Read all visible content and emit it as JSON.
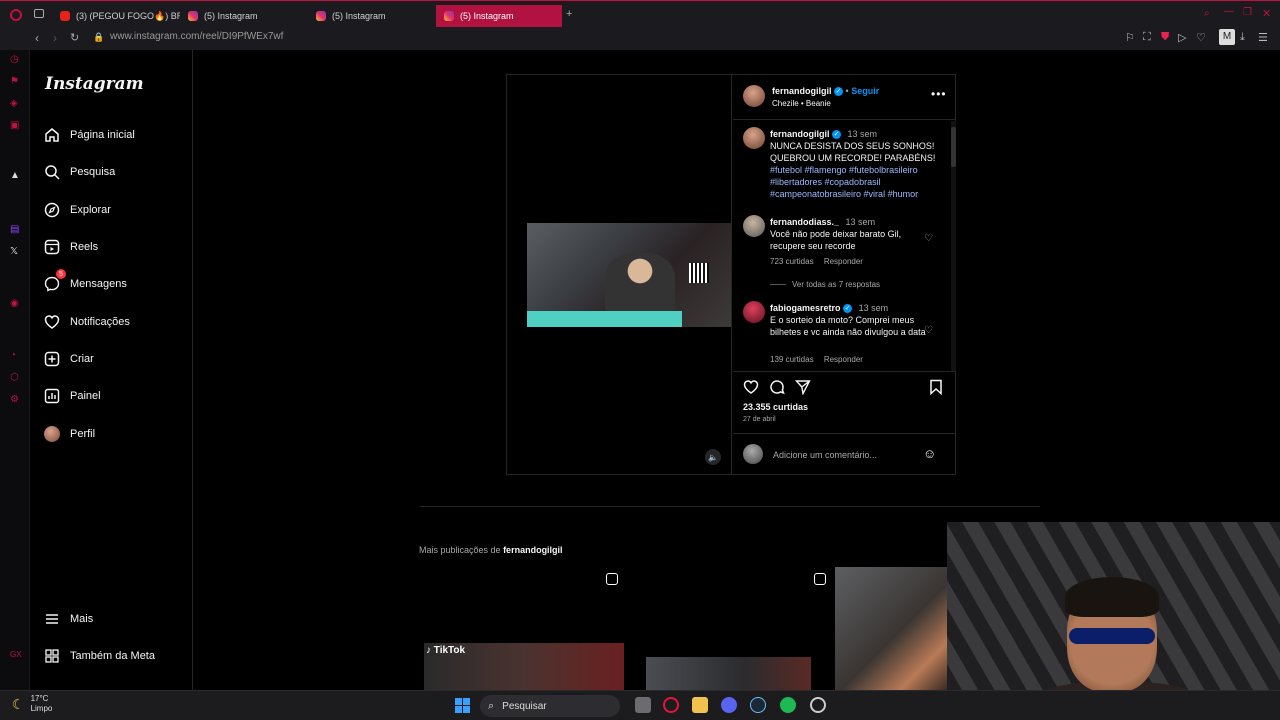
{
  "browser": {
    "tabs": [
      {
        "title": "(3) (PEGOU FOGO🔥) BR",
        "icon": "youtube-icon"
      },
      {
        "title": "(5) Instagram",
        "icon": "instagram-icon"
      },
      {
        "title": "(5) Instagram",
        "icon": "instagram-icon"
      },
      {
        "title": "(5) Instagram",
        "icon": "instagram-icon"
      }
    ],
    "new_tab": "+",
    "url": "www.instagram.com/reel/DI9PfWEx7wf"
  },
  "ig": {
    "logo": "Instagram",
    "nav": [
      {
        "label": "Página inicial",
        "icon": "home-icon"
      },
      {
        "label": "Pesquisa",
        "icon": "search-icon"
      },
      {
        "label": "Explorar",
        "icon": "compass-icon"
      },
      {
        "label": "Reels",
        "icon": "reels-icon"
      },
      {
        "label": "Mensagens",
        "icon": "messenger-icon",
        "badge": "5"
      },
      {
        "label": "Notificações",
        "icon": "heart-icon"
      },
      {
        "label": "Criar",
        "icon": "plus-icon"
      },
      {
        "label": "Painel",
        "icon": "dashboard-icon"
      },
      {
        "label": "Perfil",
        "icon": "avatar"
      }
    ],
    "more": {
      "label": "Mais",
      "icon": "menu-icon"
    },
    "meta": {
      "label": "Também da Meta",
      "icon": "grid-icon"
    }
  },
  "post": {
    "author": "fernandogilgil",
    "follow": "Seguir",
    "audio": "Chezile • Beanie",
    "caption": {
      "user": "fernandogilgil",
      "time": "13 sem",
      "text": "NUNCA DESISTA DOS SEUS SONHOS! QUEBROU UM RECORDE! PARABÉNS!",
      "tags": "#futebol #flamengo #futebolbrasileiro #libertadores #copadobrasil #campeonatobrasileiro #viral #humor"
    },
    "comments": [
      {
        "user": "fernandodiass._",
        "time": "13 sem",
        "text": "Você não pode deixar barato Gil, recupere seu recorde",
        "likes": "723 curtidas",
        "reply": "Responder",
        "view_replies": "Ver todas as 7 respostas"
      },
      {
        "user": "fabiogamesretro",
        "time": "13 sem",
        "text": "E o sorteio da moto? Comprei meus bilhetes e vc ainda não divulgou a data",
        "likes": "139 curtidas",
        "reply": "Responder"
      }
    ],
    "likes": "23.355 curtidas",
    "date": "27 de abril",
    "comment_placeholder": "Adicione um comentário..."
  },
  "more_section": {
    "prefix": "Mais publicações de",
    "user": "fernandogilgil"
  },
  "taskbar": {
    "temp": "17°C",
    "condition": "Limpo",
    "search": "Pesquisar"
  },
  "colors": {
    "accent": "#c0113f",
    "link": "#0095f6",
    "verified": "#0095f6"
  }
}
